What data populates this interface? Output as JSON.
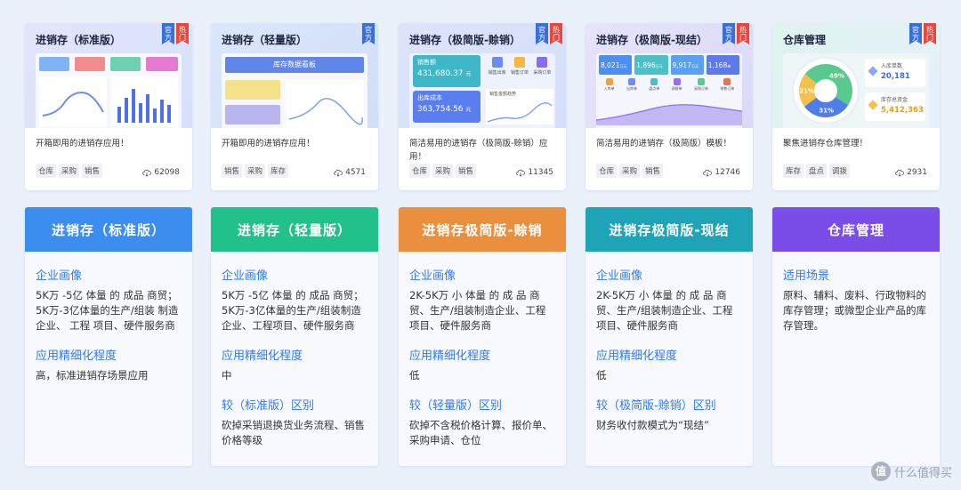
{
  "template_cards": [
    {
      "title": "进销存（标准版）",
      "tags": [
        "官方",
        "热门"
      ],
      "desc": "开箱即用的进销存应用！",
      "chips": [
        "仓库",
        "采购",
        "销售"
      ],
      "downloads": "62098"
    },
    {
      "title": "进销存（轻量版）",
      "tags": [
        "官方"
      ],
      "desc": "开箱即用的进销存应用！",
      "chips": [
        "销售",
        "采购",
        "库存"
      ],
      "downloads": "4571",
      "mock": {
        "banner": "库存数据看板"
      }
    },
    {
      "title": "进销存（极简版-赊销）",
      "tags": [
        "官方",
        "热门"
      ],
      "desc": "简洁易用的进销存（极简版-赊销）应用！",
      "chips": [
        "仓库",
        "采购",
        "销售"
      ],
      "downloads": "11345",
      "mock": {
        "kpi1_label": "销售额",
        "kpi1_value": "431,680.37",
        "kpi2_label": "出库成本",
        "kpi2_value": "363,754.56",
        "unit": "元",
        "chart_title": "销售金额趋势",
        "icons": [
          "销售出库",
          "销售订单",
          "采购订单"
        ]
      }
    },
    {
      "title": "进销存（极简版-现结）",
      "tags": [
        "官方",
        "热门"
      ],
      "desc": "简洁易用的进销存（极简版）模板！",
      "chips": [
        "仓库",
        "采购",
        "销售"
      ],
      "downloads": "12746",
      "mock": {
        "kpis": [
          {
            "value": "8,021",
            "unit": "万元"
          },
          {
            "value": "1,896",
            "unit": "万元"
          },
          {
            "value": "9,917",
            "unit": "万元"
          },
          {
            "value": "1,168",
            "unit": "单"
          }
        ],
        "icons": [
          "入库单",
          "出库单",
          "盘点单",
          "调拨单",
          "采购订单",
          "销售订单"
        ]
      }
    },
    {
      "title": "仓库管理",
      "tags": [
        "官方",
        "热门"
      ],
      "desc": "聚焦进销存仓库管理！",
      "chips": [
        "库存",
        "盘点",
        "调拨"
      ],
      "downloads": "2931",
      "mock": {
        "pie_slices": [
          {
            "label": "49%",
            "value": 49,
            "color": "#5ac98e"
          },
          {
            "label": "31%",
            "value": 31,
            "color": "#4f7ee8"
          },
          {
            "label": "21%",
            "value": 21,
            "color": "#f2c14b"
          }
        ],
        "stat1_label": "入库单数",
        "stat1_value": "20,181",
        "stat2_label": "库存总资金",
        "stat2_value": "5,412,363"
      }
    }
  ],
  "plan_cards": [
    {
      "header": "进销存（标准版）",
      "color": "#3b8df0",
      "sections": [
        {
          "title": "企业画像",
          "text": "5K万 -5亿 体量 的 成品 商贸；5K万-3亿体量的生产/组装 制造 企业、 工程 项目、硬件服务商"
        },
        {
          "title": "应用精细化程度",
          "text": "高，标准进销存场景应用"
        }
      ]
    },
    {
      "header": "进销存（轻量版）",
      "color": "#22c08a",
      "sections": [
        {
          "title": "企业画像",
          "text": "5K万 -5亿 体量 的 成品 商贸；5K万-3亿体量的生产/组装制造企业、工程项目、硬件服务商"
        },
        {
          "title": "应用精细化程度",
          "text": "中"
        },
        {
          "title": "较（标准版）区别",
          "text": "砍掉采销退换货业务流程、销售价格等级"
        }
      ]
    },
    {
      "header": "进销存极简版-赊销",
      "color": "#e98f3e",
      "sections": [
        {
          "title": "企业画像",
          "text": "2K-5K万 小 体量 的 成 品 商贸、生产/组装制造企业、工程项目、硬件服务商"
        },
        {
          "title": "应用精细化程度",
          "text": "低"
        },
        {
          "title": "较（轻量版）区别",
          "text": "砍掉不含税价格计算、报价单、采购申请、仓位"
        }
      ]
    },
    {
      "header": "进销存极简版-现结",
      "color": "#1fa3b6",
      "sections": [
        {
          "title": "企业画像",
          "text": "2K-5K万 小 体量 的 成 品 商贸、生产/组装制造企业、工程项目、硬件服务商"
        },
        {
          "title": "应用精细化程度",
          "text": "低"
        },
        {
          "title": "较（极简版-赊销）区别",
          "text": "财务收付款模式为“现结”"
        }
      ]
    },
    {
      "header": "仓库管理",
      "color": "#7b4de8",
      "sections": [
        {
          "title": "适用场景",
          "text": "原料、辅料、废料、行政物料的库存管理；或微型企业产品的库存管理。"
        }
      ]
    }
  ],
  "watermark": {
    "logo": "值",
    "text": "什么值得买"
  }
}
